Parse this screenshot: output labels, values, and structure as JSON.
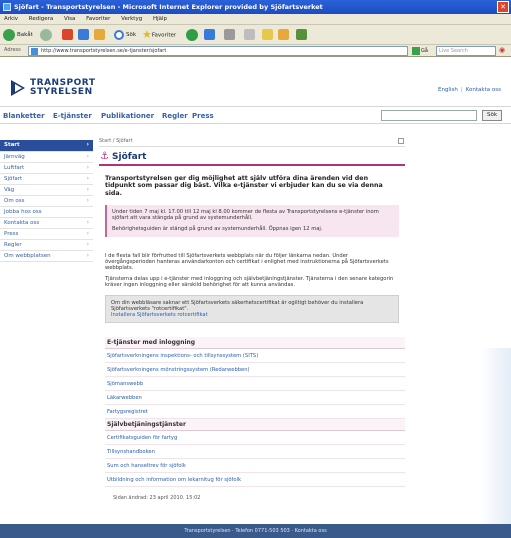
{
  "window": {
    "title": "Sjöfart - Transportstyrelsen - Microsoft Internet Explorer provided by Sjöfartsverket",
    "close_label": "✕"
  },
  "menubar": [
    "Arkiv",
    "Redigera",
    "Visa",
    "Favoriter",
    "Verktyg",
    "Hjälp"
  ],
  "toolbar": {
    "back_label": "Bakåt",
    "search_label": "Sök",
    "favorites_label": "Favoriter"
  },
  "addressbar": {
    "label": "Adress",
    "url": "http://www.transportstyrelsen.se/e-tjanster/sjofart",
    "go_label": "Gå till",
    "live_search_placeholder": "Live Search"
  },
  "site": {
    "logo_line1": "TRANSPORT",
    "logo_line2": "STYRELSEN",
    "toplinks": {
      "english": "English",
      "contact": "Kontakta oss"
    },
    "mainnav": [
      "Blanketter",
      "E-tjänster",
      "Publikationer",
      "Regler",
      "Press"
    ],
    "search_button": "Sök"
  },
  "leftnav": [
    "Start",
    "Järnväg",
    "Luftfart",
    "Sjöfart",
    "Väg",
    "Om oss",
    "Jobba hos oss",
    "Kontakta oss",
    "Press",
    "Regler",
    "Om webbplatsen"
  ],
  "content": {
    "breadcrumb": "Start / Sjöfart",
    "heading": "Sjöfart",
    "ingress": "Transportstyrelsen ger dig möjlighet att själv utföra dina ärenden vid den tidpunkt som passar dig bäst. Vilka e-tjänster vi erbjuder kan du se via denna sida.",
    "notice_1": "Under tiden 7 maj kl. 17.00 till 12 maj kl 8.00 kommer de flesta av Transportstyrelsens e-tjänster inom sjöfart att vara stängda på grund av systemunderhåll.",
    "notice_2": "Behörighetsguiden är stängd på grund av systemunderhåll. Öppnas igen 12 maj.",
    "para_1": "I de flesta fall blir förfrutted till Sjöfartsverkets webbplats när du följer länkarna nedan. Under övergångsperioden hanteras användarkonton och certifikat i enlighet med instruktionerna på Sjöfartsverkets webbplats.",
    "para_2": "Tjänsterna delas upp i e-tjänster med inloggning och självbetjäningstjänster. Tjänsterna i den senare kategorin kräver ingen inloggning eller särskild behörighet för att kunna användas.",
    "greybox_text": "Om din webbläsare saknar ett Sjöfartsverkets säkerhetscertifikat är ogiltigt behöver du installera Sjöfartsverkets \"rotcertifikat\".",
    "greybox_link": "Installera Sjöfartsverkets rotcertifikat"
  },
  "services": {
    "login_heading": "E-tjänster med inloggning",
    "login_items": [
      "Sjöfartsverkningens inspektions- och tillsynssystem (SITS)",
      "Sjöfartsverkningens mönstringssystem (Redarwebben)",
      "Sjömanswebb",
      "Läkarwebben",
      "Fartygsregistret"
    ],
    "self_heading": "Självbetjäningstjänster",
    "self_items": [
      "Certifikatsguiden för fartyg",
      "Tillsynshandboken",
      "Sum och hanseltrev för sjöfolk",
      "Utbildning och information om lekarnitug för sjöfolk"
    ],
    "last_changed": "Sidan ändrad: 23 april 2010. 15:02"
  },
  "footer": {
    "text": "Transportstyrelsen · Telefon 0771-503 503 · Kontakta oss"
  }
}
